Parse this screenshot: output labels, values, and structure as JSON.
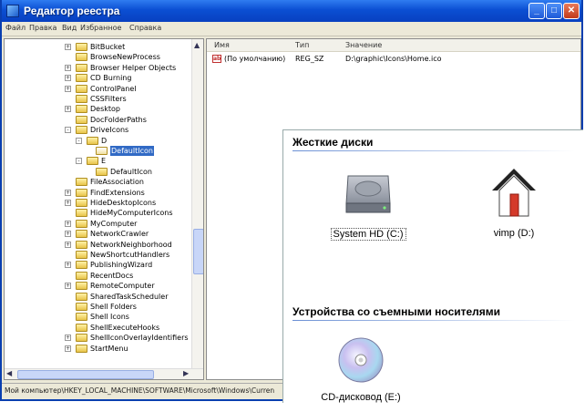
{
  "window": {
    "title": "Редактор реестра",
    "min_btn": "_",
    "max_btn": "□",
    "close_btn": "✕"
  },
  "menu": [
    "Файл",
    "Правка",
    "Вид",
    "Избранное",
    "Справка"
  ],
  "tree": [
    {
      "label": "BitBucket",
      "expander": "+"
    },
    {
      "label": "BrowseNewProcess",
      "expander": ""
    },
    {
      "label": "Browser Helper Objects",
      "expander": "+"
    },
    {
      "label": "CD Burning",
      "expander": "+"
    },
    {
      "label": "ControlPanel",
      "expander": "+"
    },
    {
      "label": "CSSFilters",
      "expander": ""
    },
    {
      "label": "Desktop",
      "expander": "+"
    },
    {
      "label": "DocFolderPaths",
      "expander": ""
    },
    {
      "label": "DriveIcons",
      "expander": "-"
    },
    {
      "label": "D",
      "expander": "-"
    },
    {
      "label": "DefaultIcon",
      "expander": "",
      "selected": true
    },
    {
      "label": "E",
      "expander": "-"
    },
    {
      "label": "DefaultIcon",
      "expander": ""
    },
    {
      "label": "FileAssociation",
      "expander": ""
    },
    {
      "label": "FindExtensions",
      "expander": "+"
    },
    {
      "label": "HideDesktopIcons",
      "expander": "+"
    },
    {
      "label": "HideMyComputerIcons",
      "expander": ""
    },
    {
      "label": "MyComputer",
      "expander": "+"
    },
    {
      "label": "NetworkCrawler",
      "expander": "+"
    },
    {
      "label": "NetworkNeighborhood",
      "expander": "+"
    },
    {
      "label": "NewShortcutHandlers",
      "expander": ""
    },
    {
      "label": "PublishingWizard",
      "expander": "+"
    },
    {
      "label": "RecentDocs",
      "expander": ""
    },
    {
      "label": "RemoteComputer",
      "expander": "+"
    },
    {
      "label": "SharedTaskScheduler",
      "expander": ""
    },
    {
      "label": "Shell Folders",
      "expander": ""
    },
    {
      "label": "Shell Icons",
      "expander": ""
    },
    {
      "label": "ShellExecuteHooks",
      "expander": ""
    },
    {
      "label": "ShellIconOverlayIdentifiers",
      "expander": "+"
    },
    {
      "label": "StartMenu",
      "expander": "+"
    }
  ],
  "list": {
    "headers": {
      "name": "Имя",
      "type": "Тип",
      "value": "Значение"
    },
    "rows": [
      {
        "name": "(По умолчанию)",
        "type": "REG_SZ",
        "value": "D:\\graphic\\Icons\\Home.ico"
      }
    ]
  },
  "statusbar": "Мой компьютер\\HKEY_LOCAL_MACHINE\\SOFTWARE\\Microsoft\\Windows\\Curren",
  "mycomputer": {
    "group_hdd": "Жесткие диски",
    "group_removable": "Устройства со съемными носителями",
    "drives": [
      {
        "label": "System HD (C:)",
        "icon": "hard-disk-icon"
      },
      {
        "label": "vimp (D:)",
        "icon": "home-icon"
      },
      {
        "label": "CD-дисковод (E:)",
        "icon": "cd-drive-icon"
      }
    ]
  }
}
